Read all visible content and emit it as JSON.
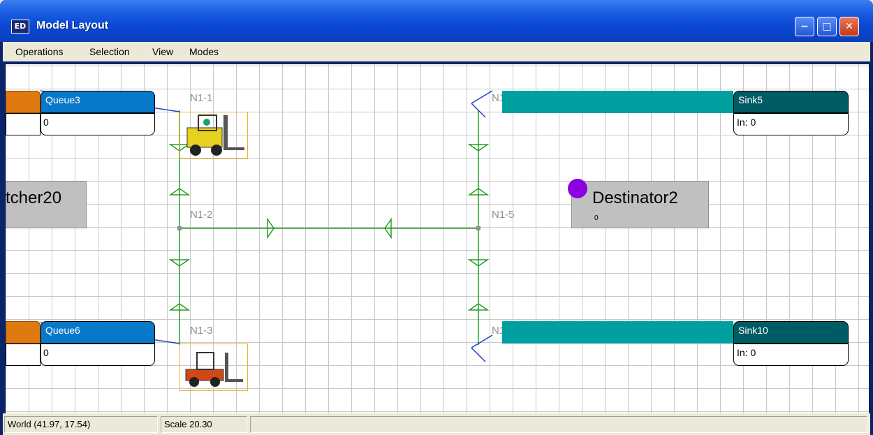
{
  "window": {
    "title": "Model Layout",
    "icon_text": "ED"
  },
  "titlebar_buttons": {
    "minimize": "−",
    "maximize": "□",
    "close": "✕"
  },
  "menu": [
    "Operations",
    "Selection",
    "View",
    "Modes"
  ],
  "status": {
    "world": "World (41.97, 17.54)",
    "scale": "Scale 20.30",
    "extra": ""
  },
  "canvas": {
    "queues": [
      {
        "name": "Queue3",
        "value": "0"
      },
      {
        "name": "Queue6",
        "value": "0"
      }
    ],
    "sinks": [
      {
        "name": "Sink5",
        "value": "In: 0"
      },
      {
        "name": "Sink10",
        "value": "In: 0"
      }
    ],
    "nodes": [
      "N1-1",
      "N1-2",
      "N1-3",
      "N1-4",
      "N1-5",
      "N1-6"
    ],
    "dispatcher_label": "tcher20",
    "destinator": {
      "name": "Destinator2",
      "value": "0"
    }
  },
  "colors": {
    "queue_header": "#0878C8",
    "sink_header": "#005C64",
    "conveyor": "#00A0A0",
    "network_line": "#22A022",
    "destinator_dot": "#8A00E0"
  }
}
